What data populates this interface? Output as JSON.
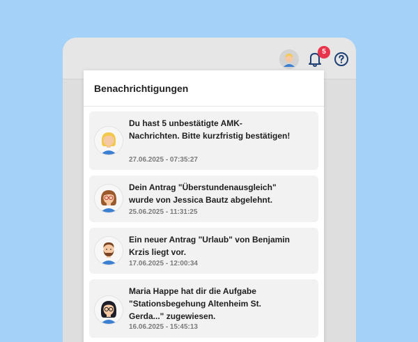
{
  "header": {
    "notification_count": "5",
    "icons": [
      "user-avatar-icon",
      "bell-icon",
      "help-icon"
    ],
    "badge_color": "#e8354b"
  },
  "panel": {
    "title": "Benachrichtigungen"
  },
  "notifications": [
    {
      "text": "Du hast 5 unbestätigte AMK-Nachrichten. Bitte kurzfristig bestätigen!",
      "date": "27.06.2025 - 07:35:27",
      "avatar": "blonde-woman-avatar"
    },
    {
      "text": "Dein Antrag \"Überstundenausgleich\" wurde von Jessica Bautz abgelehnt.",
      "date": "25.06.2025 - 11:31:25",
      "avatar": "brown-hair-woman-glasses-avatar"
    },
    {
      "text": "Ein neuer Antrag \"Urlaub\" von Benjamin Krzis liegt vor.",
      "date": "17.06.2025 - 12:00:34",
      "avatar": "bearded-man-avatar"
    },
    {
      "text": "Maria Happe hat dir die Aufgabe \"Stationsbegehung Altenheim St. Gerda...\" zugewiesen.",
      "date": "16.06.2025 - 15:45:13",
      "avatar": "dark-hair-woman-glasses-avatar"
    }
  ]
}
